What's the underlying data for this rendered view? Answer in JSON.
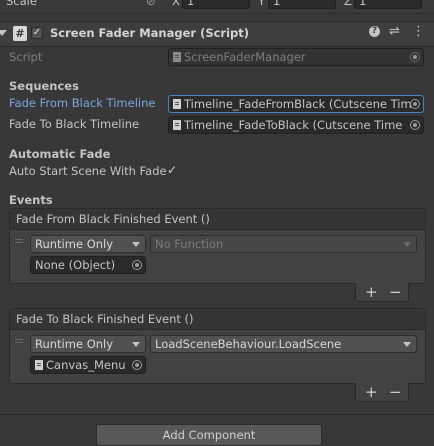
{
  "top": {
    "scale_label": "Scale",
    "axis_x": "X",
    "axis_y": "Y",
    "axis_z": "Z",
    "val_x": "1",
    "val_y": "1",
    "val_z": "1"
  },
  "component": {
    "title": "Screen Fader Manager (Script)",
    "enabled": true
  },
  "script_field": {
    "label": "Script",
    "value": "ScreenFaderManager"
  },
  "sequences": {
    "heading": "Sequences",
    "fade_from": {
      "label": "Fade From Black Timeline",
      "value": "Timeline_FadeFromBlack (Cutscene Tim"
    },
    "fade_to": {
      "label": "Fade To Black Timeline",
      "value": "Timeline_FadeToBlack (Cutscene Time"
    }
  },
  "automatic": {
    "heading": "Automatic Fade",
    "auto_start_label": "Auto Start Scene With Fade",
    "auto_start_value": true
  },
  "events": {
    "heading": "Events",
    "from_event": {
      "title": "Fade From Black Finished Event ()",
      "runtime": "Runtime Only",
      "function": "No Function",
      "target": "None (Object)"
    },
    "to_event": {
      "title": "Fade To Black Finished Event ()",
      "runtime": "Runtime Only",
      "function": "LoadSceneBehaviour.LoadScene",
      "target": "Canvas_Menu"
    },
    "plus": "+",
    "minus": "−"
  },
  "add_component": "Add Component",
  "colors": {
    "accent_label": "#7ba6dd",
    "background": "#383838",
    "field": "#2a2a2a"
  }
}
